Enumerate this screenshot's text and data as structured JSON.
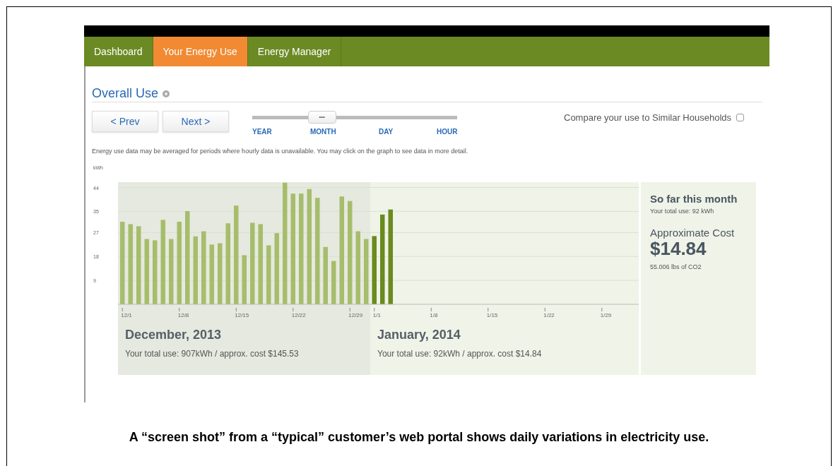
{
  "nav": {
    "tabs": [
      {
        "label": "Dashboard",
        "selected": false
      },
      {
        "label": "Your Energy Use",
        "selected": true
      },
      {
        "label": "Energy Manager",
        "selected": false
      }
    ]
  },
  "section": {
    "title": "Overall Use"
  },
  "buttons": {
    "prev": "< Prev",
    "next": "Next >"
  },
  "scale": {
    "level": 0.34,
    "thumb": "•••",
    "labels": [
      "YEAR",
      "MONTH",
      "DAY",
      "HOUR"
    ]
  },
  "compare": {
    "label": "Compare your use to Similar Households",
    "checked": false
  },
  "note": "Energy use data may be averaged for periods where hourly data is unavailable. You may click on the graph to see data in more detail.",
  "chart_data": {
    "type": "bar",
    "ylabel": "kWh",
    "ylim": [
      0,
      46
    ],
    "grid": true,
    "yticks": [
      9,
      18,
      27,
      35,
      44
    ],
    "categories": [
      "12/1",
      null,
      null,
      null,
      null,
      null,
      null,
      "12/8",
      null,
      null,
      null,
      null,
      null,
      null,
      "12/15",
      null,
      null,
      null,
      null,
      null,
      null,
      "12/22",
      null,
      null,
      null,
      null,
      null,
      null,
      "12/29",
      null,
      null,
      "1/1",
      null,
      null,
      null,
      null,
      null,
      null,
      "1/8",
      null,
      null,
      null,
      null,
      null,
      null,
      "1/15",
      null,
      null,
      null,
      null,
      null,
      null,
      "1/22",
      null,
      null,
      null,
      null,
      null,
      null,
      "1/29",
      null,
      null
    ],
    "series": [
      {
        "name": "December, 2013",
        "color": "#a6bd6c",
        "values": [
          31.1,
          30.2,
          29.4,
          24.6,
          24.1,
          31.8,
          24.6,
          31.1,
          35.1,
          25.6,
          27.5,
          22.5,
          23.0,
          30.5,
          37.2,
          18.5,
          30.7,
          30.2,
          22.2,
          26.8,
          45.8,
          41.7,
          41.7,
          43.4,
          40.1,
          21.6,
          16.3,
          40.6,
          38.9,
          27.5,
          24.6,
          null,
          null,
          null,
          null,
          null,
          null,
          null,
          null,
          null,
          null,
          null,
          null,
          null,
          null,
          null,
          null,
          null,
          null,
          null,
          null,
          null,
          null,
          null,
          null,
          null,
          null,
          null,
          null,
          null,
          null,
          null
        ]
      },
      {
        "name": "January, 2014",
        "color": "#6b8a1f",
        "values": [
          null,
          null,
          null,
          null,
          null,
          null,
          null,
          null,
          null,
          null,
          null,
          null,
          null,
          null,
          null,
          null,
          null,
          null,
          null,
          null,
          null,
          null,
          null,
          null,
          null,
          null,
          null,
          null,
          null,
          null,
          null,
          25.7,
          33.8,
          35.7,
          null,
          null,
          null,
          null,
          null,
          null,
          null,
          null,
          null,
          null,
          null,
          null,
          null,
          null,
          null,
          null,
          null,
          null,
          null,
          null,
          null,
          null,
          null,
          null,
          null,
          null,
          null,
          null
        ]
      }
    ]
  },
  "months": [
    {
      "total": "Your total use: 907kWh / approx. cost $145.53"
    },
    {
      "total": "Your total use: 92kWh / approx. cost $14.84"
    }
  ],
  "summary": {
    "title": "So far this month",
    "total": "Your total use: 92 kWh",
    "cost_label": "Approximate Cost",
    "cost": "$14.84",
    "co2": "55.006 lbs of CO2"
  },
  "caption": "A “screen shot” from a “typical” customer’s web portal shows daily variations in electricity use."
}
